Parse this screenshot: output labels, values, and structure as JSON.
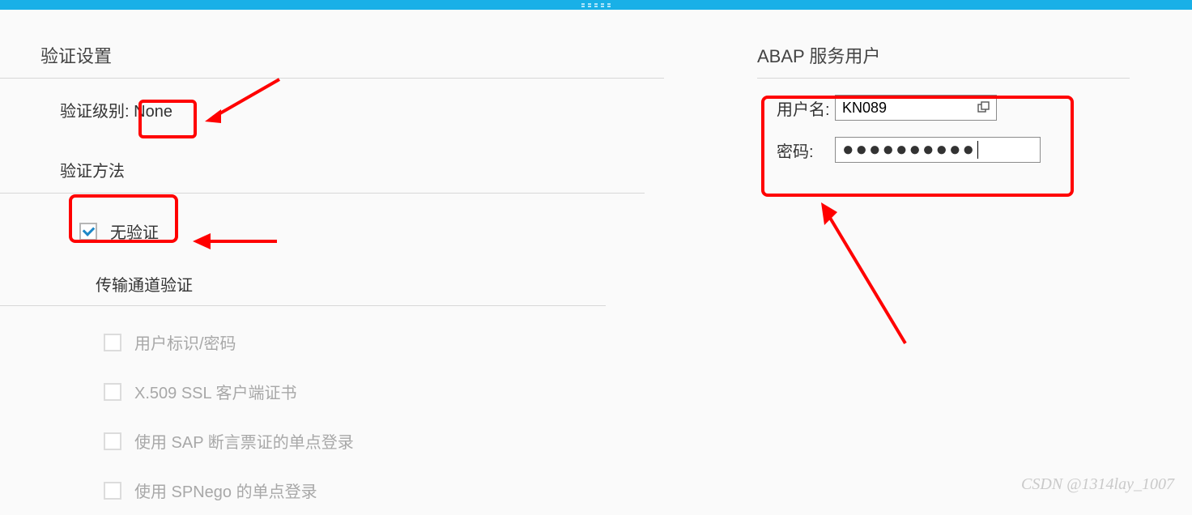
{
  "topbar": {},
  "left": {
    "title": "验证设置",
    "auth_level_label": "验证级别:",
    "auth_level_value": "None",
    "auth_method_title": "验证方法",
    "no_auth_label": "无验证",
    "no_auth_checked": true,
    "transport_title": "传输通道验证",
    "items": [
      {
        "label": "用户标识/密码"
      },
      {
        "label": "X.509 SSL 客户端证书"
      },
      {
        "label": "使用 SAP 断言票证的单点登录"
      },
      {
        "label": "使用 SPNego 的单点登录"
      }
    ]
  },
  "right": {
    "title": "ABAP 服务用户",
    "username_label": "用户名:",
    "username_value": "KN089",
    "password_label": "密码:",
    "password_value_masked": "●●●●●●●●●●"
  },
  "watermark": "CSDN @1314lay_1007"
}
